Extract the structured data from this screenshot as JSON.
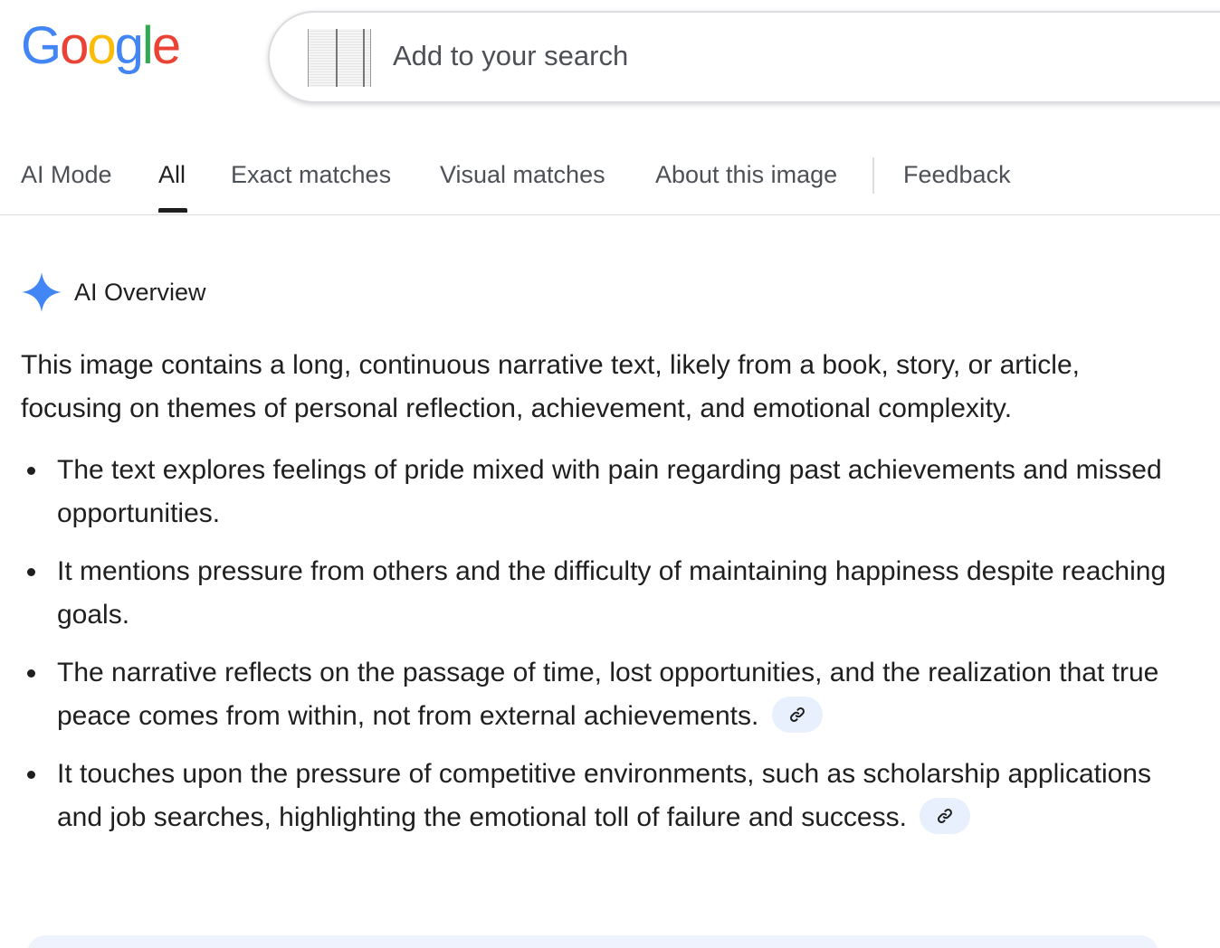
{
  "logo": {
    "letters": [
      "G",
      "o",
      "o",
      "g",
      "l",
      "e"
    ],
    "colors": [
      "#4285F4",
      "#EA4335",
      "#FBBC05",
      "#4285F4",
      "#34A853",
      "#EA4335"
    ]
  },
  "search": {
    "placeholder": "Add to your search"
  },
  "tabs": [
    {
      "label": "AI Mode",
      "active": false
    },
    {
      "label": "All",
      "active": true
    },
    {
      "label": "Exact matches",
      "active": false
    },
    {
      "label": "Visual matches",
      "active": false
    },
    {
      "label": "About this image",
      "active": false
    },
    {
      "label": "Feedback",
      "active": false
    }
  ],
  "ai_overview": {
    "title": "AI Overview",
    "accent_color": "#4285F4",
    "summary": "This image contains a long, continuous narrative text, likely from a book, story, or article, focusing on themes of personal reflection, achievement, and emotional complexity.",
    "bullets": [
      {
        "text": "The text explores feelings of pride mixed with pain regarding past achievements and missed opportunities.",
        "has_link": false
      },
      {
        "text": "It mentions pressure from others and the difficulty of maintaining happiness despite reaching goals.",
        "has_link": false
      },
      {
        "text": "The narrative reflects on the passage of time, lost opportunities, and the realization that true peace comes from within, not from external achievements.",
        "has_link": true
      },
      {
        "text": "It touches upon the pressure of competitive environments, such as scholarship applications and job searches, highlighting the emotional toll of failure and success.",
        "has_link": true
      }
    ]
  },
  "icons": {
    "ai_overview": "sparkle-icon",
    "citation": "link-icon"
  }
}
